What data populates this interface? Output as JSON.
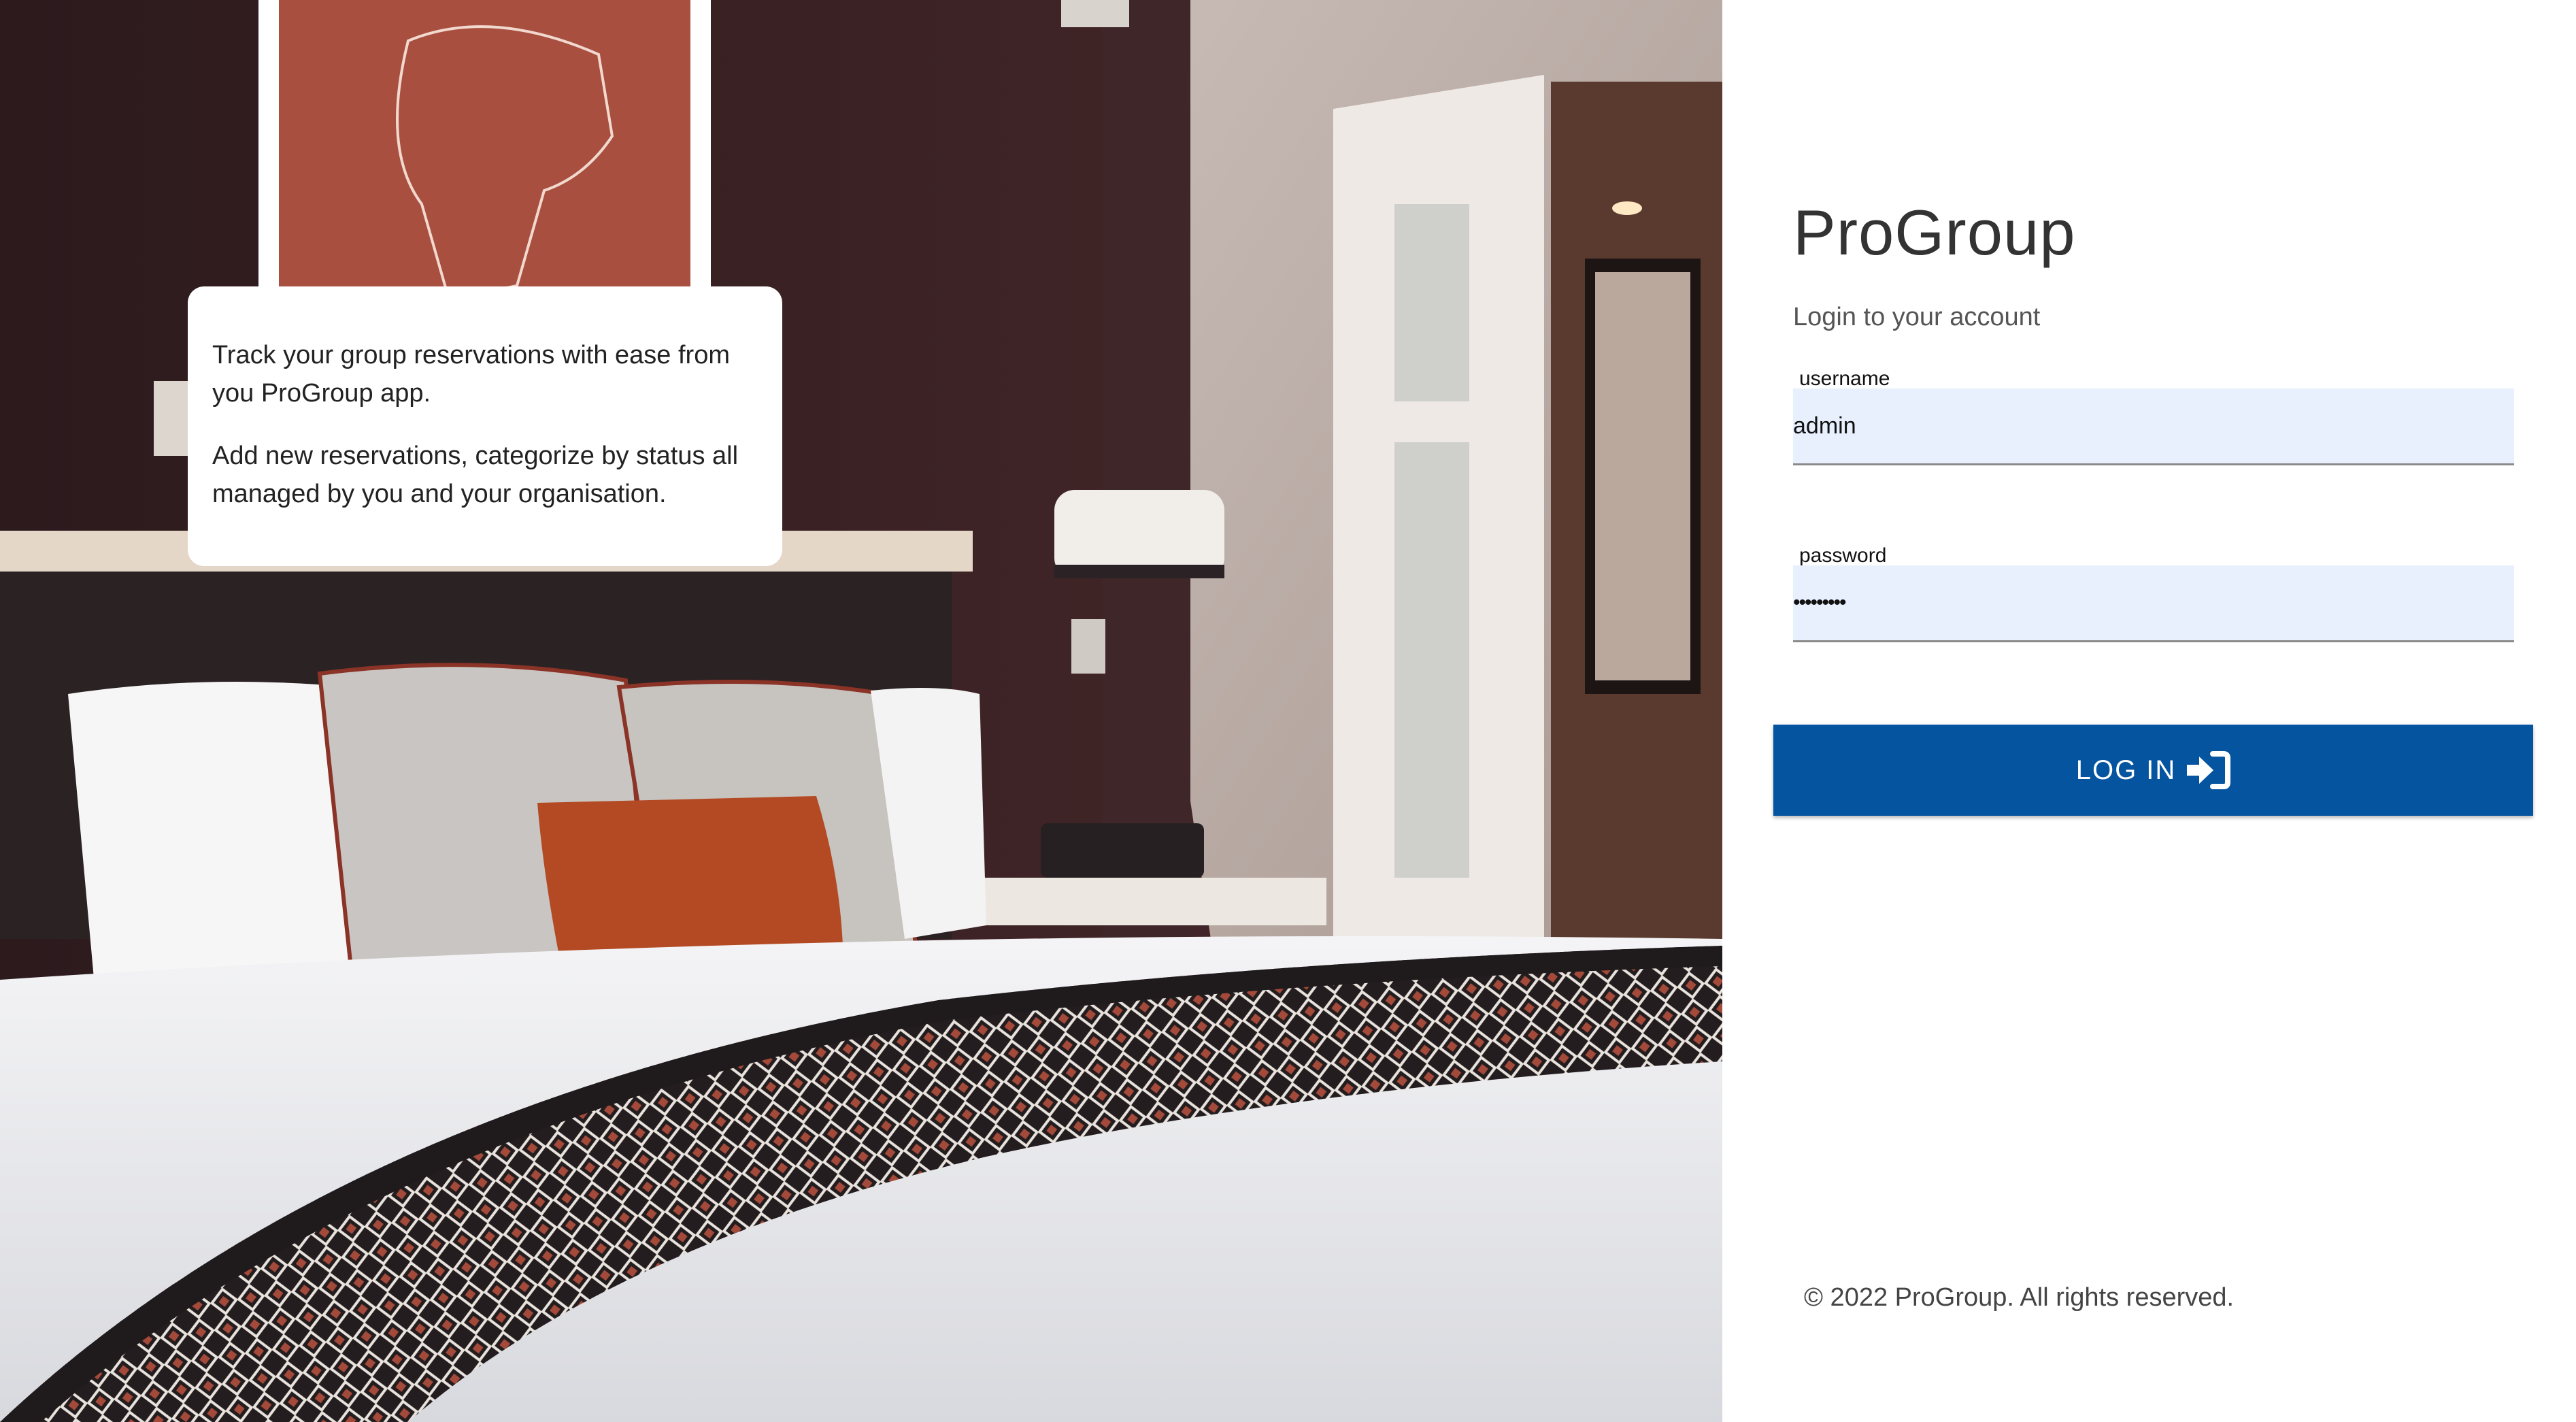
{
  "hero": {
    "image_alt": "Hotel bedroom photo",
    "info_card": {
      "line1": "Track your group reservations with ease from you ProGroup app.",
      "line2": "Add new reservations, categorize by status all managed by you and your organisation."
    }
  },
  "login": {
    "title": "ProGroup",
    "subtitle": "Login to your account",
    "username": {
      "label": "username",
      "value": "admin"
    },
    "password": {
      "label": "password",
      "value": "•••••••••"
    },
    "submit_label": "LOG IN",
    "submit_icon": "sign-in-icon"
  },
  "footer": {
    "copyright": "© 2022 ProGroup. All rights reserved."
  },
  "colors": {
    "primary": "#0554a0",
    "input_bg": "#e8f0fe",
    "panel_bg": "#ffffff"
  }
}
